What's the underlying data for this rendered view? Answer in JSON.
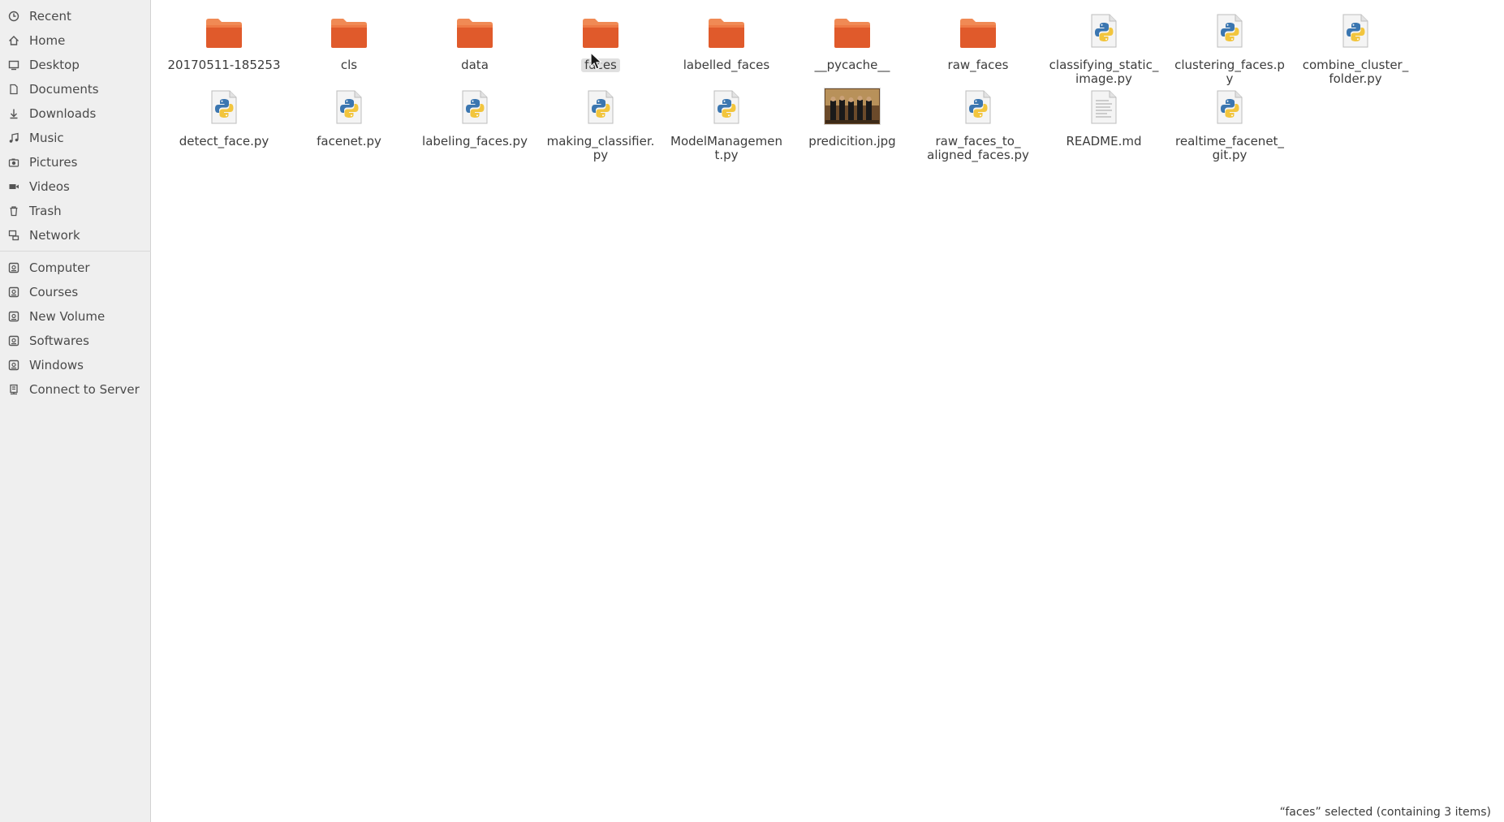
{
  "sidebar": {
    "items": [
      {
        "label": "Recent",
        "icon": "clock-icon"
      },
      {
        "label": "Home",
        "icon": "home-icon"
      },
      {
        "label": "Desktop",
        "icon": "desktop-icon"
      },
      {
        "label": "Documents",
        "icon": "document-icon"
      },
      {
        "label": "Downloads",
        "icon": "download-icon"
      },
      {
        "label": "Music",
        "icon": "music-icon"
      },
      {
        "label": "Pictures",
        "icon": "camera-icon"
      },
      {
        "label": "Videos",
        "icon": "video-icon"
      },
      {
        "label": "Trash",
        "icon": "trash-icon"
      },
      {
        "label": "Network",
        "icon": "network-icon"
      }
    ],
    "devices": [
      {
        "label": "Computer",
        "icon": "drive-icon"
      },
      {
        "label": "Courses",
        "icon": "drive-icon"
      },
      {
        "label": "New Volume",
        "icon": "drive-icon"
      },
      {
        "label": "Softwares",
        "icon": "drive-icon"
      },
      {
        "label": "Windows",
        "icon": "drive-icon"
      },
      {
        "label": "Connect to Server",
        "icon": "server-icon"
      }
    ]
  },
  "files": [
    {
      "name": "20170511-185253",
      "type": "folder"
    },
    {
      "name": "cls",
      "type": "folder"
    },
    {
      "name": "data",
      "type": "folder"
    },
    {
      "name": "faces",
      "type": "folder",
      "selected": true
    },
    {
      "name": "labelled_faces",
      "type": "folder"
    },
    {
      "name": "__pycache__",
      "type": "folder"
    },
    {
      "name": "raw_faces",
      "type": "folder"
    },
    {
      "name": "classifying_static_\nimage.py",
      "type": "python"
    },
    {
      "name": "clustering_faces.py",
      "type": "python"
    },
    {
      "name": "combine_cluster_\nfolder.py",
      "type": "python"
    },
    {
      "name": "detect_face.py",
      "type": "python"
    },
    {
      "name": "facenet.py",
      "type": "python"
    },
    {
      "name": "labeling_faces.py",
      "type": "python"
    },
    {
      "name": "making_classifier.\npy",
      "type": "python"
    },
    {
      "name": "ModelManagemen\nt.py",
      "type": "python"
    },
    {
      "name": "predicition.jpg",
      "type": "image"
    },
    {
      "name": "raw_faces_to_\naligned_faces.py",
      "type": "python"
    },
    {
      "name": "README.md",
      "type": "text"
    },
    {
      "name": "realtime_facenet_\ngit.py",
      "type": "python"
    }
  ],
  "status": {
    "text": "“faces” selected  (containing 3 items)"
  },
  "colors": {
    "folder": "#e05a2b",
    "folder_tab": "#f08a55",
    "sidebar_bg": "#efefef",
    "selection": "#e0e0e0"
  }
}
